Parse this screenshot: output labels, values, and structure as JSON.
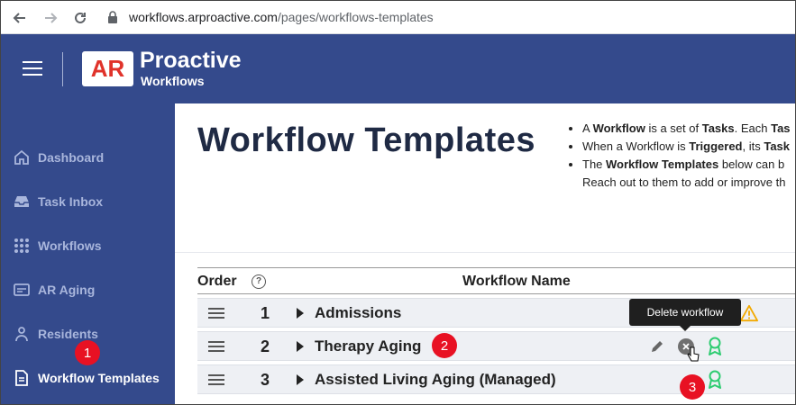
{
  "browser": {
    "url_host": "workflows.arproactive.com",
    "url_path": "/pages/workflows-templates"
  },
  "header": {
    "logo_mark": "AR",
    "logo_title": "Proactive",
    "logo_subtitle": "Workflows"
  },
  "sidebar": {
    "items": [
      {
        "label": "Dashboard",
        "icon": "home-icon"
      },
      {
        "label": "Task Inbox",
        "icon": "inbox-icon"
      },
      {
        "label": "Workflows",
        "icon": "grid-icon"
      },
      {
        "label": "AR Aging",
        "icon": "card-icon"
      },
      {
        "label": "Residents",
        "icon": "person-icon"
      },
      {
        "label": "Workflow Templates",
        "icon": "document-icon",
        "active": true
      }
    ]
  },
  "main": {
    "title": "Workflow Templates",
    "info": [
      {
        "prefix": "A ",
        "b1": "Workflow",
        "mid": " is a set of ",
        "b2": "Tasks",
        "suffix": ". Each ",
        "b3": "Tas"
      },
      {
        "prefix": "When a Workflow is ",
        "b1": "Triggered",
        "mid": ", its ",
        "b2": "Task",
        "suffix": "",
        "b3": ""
      },
      {
        "prefix": "The ",
        "b1": "Workflow Templates",
        "mid": " below can b",
        "b2": "",
        "suffix": "",
        "b3": ""
      }
    ],
    "info_cont": "Reach out to them to add or improve th"
  },
  "table": {
    "col_order": "Order",
    "col_help": "?",
    "col_name": "Workflow Name",
    "rows": [
      {
        "order": "1",
        "name": "Admissions"
      },
      {
        "order": "2",
        "name": "Therapy Aging"
      },
      {
        "order": "3",
        "name": "Assisted Living Aging (Managed)"
      }
    ]
  },
  "tooltip": {
    "text": "Delete workflow"
  },
  "callouts": [
    "1",
    "2",
    "3"
  ],
  "colors": {
    "brand_blue": "#344a8c",
    "logo_red": "#e0332b",
    "badge_green": "#2ecc71",
    "warning": "#f2a900",
    "callout_red": "#e81123"
  }
}
